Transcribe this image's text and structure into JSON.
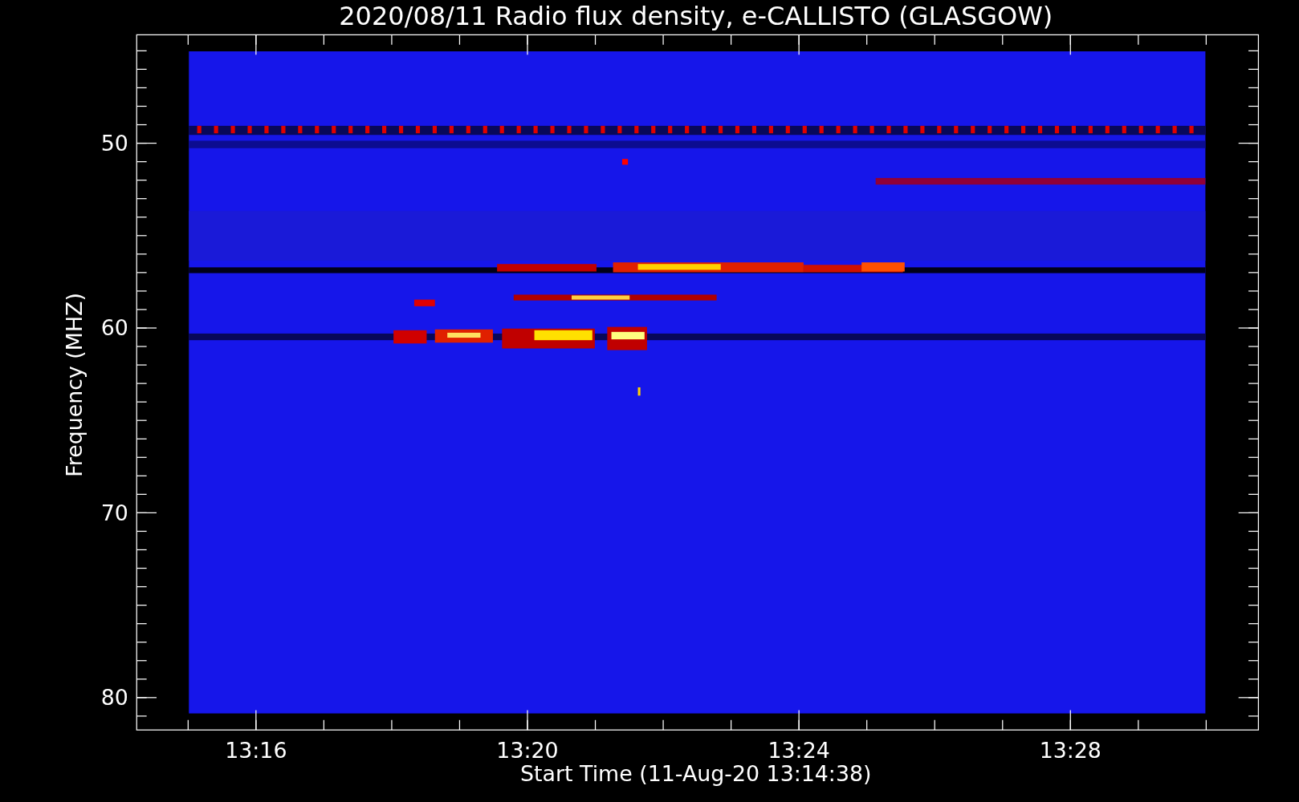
{
  "title": "2020/08/11  Radio flux density, e-CALLISTO (GLASGOW)",
  "ylabel": "Frequency (MHZ)",
  "xlabel": "Start Time (11-Aug-20 13:14:38)",
  "yticks": [
    "50",
    "60",
    "70",
    "80"
  ],
  "xticks": [
    "13:16",
    "13:20",
    "13:24",
    "13:28"
  ]
}
